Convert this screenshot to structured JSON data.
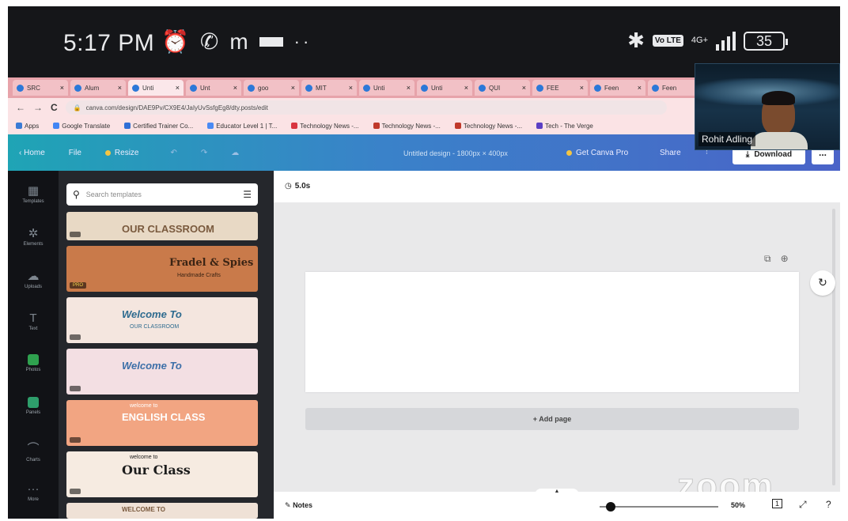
{
  "status_bar": {
    "time": "5:17 PM",
    "volte_label": "Vo LTE",
    "network": "4G+",
    "battery": "35"
  },
  "browser": {
    "tabs": [
      {
        "label": "SRC"
      },
      {
        "label": "Alum"
      },
      {
        "label": "Unti"
      },
      {
        "label": "Unt"
      },
      {
        "label": "goo"
      },
      {
        "label": "MIT"
      },
      {
        "label": "Unti"
      },
      {
        "label": "Unti"
      },
      {
        "label": "QUI"
      },
      {
        "label": "FEE"
      },
      {
        "label": "Feen"
      },
      {
        "label": "Feen"
      }
    ],
    "url": "canva.com/design/DAE9Pv/CX9E4/JaIyUvSsfgEg8/dty.posts/edit",
    "bookmarks": [
      {
        "label": "Apps",
        "color": "#3a7bd5"
      },
      {
        "label": "Google Translate",
        "color": "#4285f4"
      },
      {
        "label": "Certified Trainer Co...",
        "color": "#2f6fd6"
      },
      {
        "label": "Educator Level 1 | T...",
        "color": "#4a8af4"
      },
      {
        "label": "Technology News -...",
        "color": "#d9343f"
      },
      {
        "label": "Technology News -...",
        "color": "#c0392b"
      },
      {
        "label": "Technology News -...",
        "color": "#c0392b"
      },
      {
        "label": "Tech - The Verge",
        "color": "#5b3fc4"
      }
    ]
  },
  "canva_header": {
    "home": "Home",
    "file": "File",
    "resize": "Resize",
    "title": "Untitled design - 1800px × 400px",
    "get_pro": "Get Canva Pro",
    "share": "Share",
    "download": "Download",
    "more": "..."
  },
  "video": {
    "name": "Rohit Adling"
  },
  "sidebar": {
    "items": [
      {
        "label": "Templates",
        "icon": "templates-icon",
        "glyph": "▦"
      },
      {
        "label": "Elements",
        "icon": "elements-icon",
        "glyph": "✲"
      },
      {
        "label": "Uploads",
        "icon": "uploads-icon",
        "glyph": "☁"
      },
      {
        "label": "Text",
        "icon": "text-icon",
        "glyph": "T"
      },
      {
        "label": "Photos",
        "icon": "photos-icon",
        "glyph": "■"
      },
      {
        "label": "Panels",
        "icon": "panels-icon",
        "glyph": "■"
      },
      {
        "label": "Charts",
        "icon": "charts-icon",
        "glyph": "⌒"
      },
      {
        "label": "More",
        "icon": "more-icon",
        "glyph": "···"
      }
    ]
  },
  "templates": {
    "search_placeholder": "Search templates",
    "cards": [
      {
        "title": "OUR CLASSROOM",
        "subtitle": "",
        "bg": "#e8d9c5",
        "fg": "#7a5a3e",
        "badge": "",
        "h": 36
      },
      {
        "title": "Fradel & Spies",
        "subtitle": "Handmade Crafts",
        "bg": "#c97a4a",
        "fg": "#3b2414",
        "badge": "PRO",
        "h": 58
      },
      {
        "title": "Welcome To",
        "subtitle": "OUR CLASSROOM",
        "bg": "#f4e6df",
        "fg": "#2e6b8f",
        "badge": "",
        "h": 58
      },
      {
        "title": "Welcome To",
        "subtitle": "",
        "bg": "#f3dfe3",
        "fg": "#3c6fa8",
        "badge": "",
        "h": 58
      },
      {
        "title": "ENGLISH CLASS",
        "subtitle": "welcome to",
        "bg": "#f2a582",
        "fg": "#ffffff",
        "badge": "",
        "h": 58
      },
      {
        "title": "Our Class",
        "subtitle": "welcome to",
        "bg": "#f6ebe1",
        "fg": "#1d1d1d",
        "badge": "",
        "h": 58
      },
      {
        "title": "WELCOME TO",
        "subtitle": "",
        "bg": "#efe1d6",
        "fg": "#7a5a3e",
        "badge": "",
        "h": 20
      }
    ]
  },
  "editor": {
    "timer": "5.0s",
    "add_page": "+ Add page",
    "notes": "Notes",
    "zoom": "50%",
    "zoom_fraction": 0.05,
    "page_number": "1",
    "watermark": "zoom"
  }
}
